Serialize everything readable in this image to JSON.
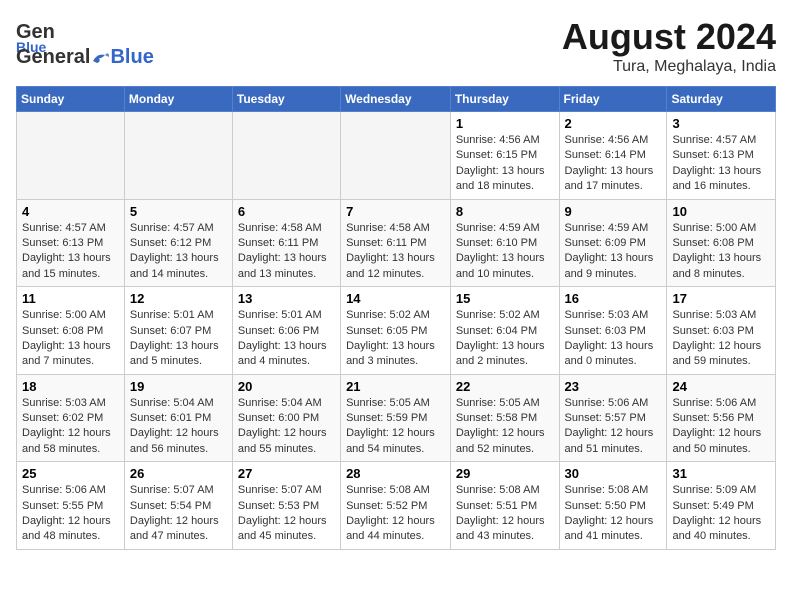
{
  "header": {
    "logo_general": "General",
    "logo_blue": "Blue",
    "title": "August 2024",
    "subtitle": "Tura, Meghalaya, India"
  },
  "weekdays": [
    "Sunday",
    "Monday",
    "Tuesday",
    "Wednesday",
    "Thursday",
    "Friday",
    "Saturday"
  ],
  "weeks": [
    [
      {
        "day": "",
        "info": ""
      },
      {
        "day": "",
        "info": ""
      },
      {
        "day": "",
        "info": ""
      },
      {
        "day": "",
        "info": ""
      },
      {
        "day": "1",
        "info": "Sunrise: 4:56 AM\nSunset: 6:15 PM\nDaylight: 13 hours\nand 18 minutes."
      },
      {
        "day": "2",
        "info": "Sunrise: 4:56 AM\nSunset: 6:14 PM\nDaylight: 13 hours\nand 17 minutes."
      },
      {
        "day": "3",
        "info": "Sunrise: 4:57 AM\nSunset: 6:13 PM\nDaylight: 13 hours\nand 16 minutes."
      }
    ],
    [
      {
        "day": "4",
        "info": "Sunrise: 4:57 AM\nSunset: 6:13 PM\nDaylight: 13 hours\nand 15 minutes."
      },
      {
        "day": "5",
        "info": "Sunrise: 4:57 AM\nSunset: 6:12 PM\nDaylight: 13 hours\nand 14 minutes."
      },
      {
        "day": "6",
        "info": "Sunrise: 4:58 AM\nSunset: 6:11 PM\nDaylight: 13 hours\nand 13 minutes."
      },
      {
        "day": "7",
        "info": "Sunrise: 4:58 AM\nSunset: 6:11 PM\nDaylight: 13 hours\nand 12 minutes."
      },
      {
        "day": "8",
        "info": "Sunrise: 4:59 AM\nSunset: 6:10 PM\nDaylight: 13 hours\nand 10 minutes."
      },
      {
        "day": "9",
        "info": "Sunrise: 4:59 AM\nSunset: 6:09 PM\nDaylight: 13 hours\nand 9 minutes."
      },
      {
        "day": "10",
        "info": "Sunrise: 5:00 AM\nSunset: 6:08 PM\nDaylight: 13 hours\nand 8 minutes."
      }
    ],
    [
      {
        "day": "11",
        "info": "Sunrise: 5:00 AM\nSunset: 6:08 PM\nDaylight: 13 hours\nand 7 minutes."
      },
      {
        "day": "12",
        "info": "Sunrise: 5:01 AM\nSunset: 6:07 PM\nDaylight: 13 hours\nand 5 minutes."
      },
      {
        "day": "13",
        "info": "Sunrise: 5:01 AM\nSunset: 6:06 PM\nDaylight: 13 hours\nand 4 minutes."
      },
      {
        "day": "14",
        "info": "Sunrise: 5:02 AM\nSunset: 6:05 PM\nDaylight: 13 hours\nand 3 minutes."
      },
      {
        "day": "15",
        "info": "Sunrise: 5:02 AM\nSunset: 6:04 PM\nDaylight: 13 hours\nand 2 minutes."
      },
      {
        "day": "16",
        "info": "Sunrise: 5:03 AM\nSunset: 6:03 PM\nDaylight: 13 hours\nand 0 minutes."
      },
      {
        "day": "17",
        "info": "Sunrise: 5:03 AM\nSunset: 6:03 PM\nDaylight: 12 hours\nand 59 minutes."
      }
    ],
    [
      {
        "day": "18",
        "info": "Sunrise: 5:03 AM\nSunset: 6:02 PM\nDaylight: 12 hours\nand 58 minutes."
      },
      {
        "day": "19",
        "info": "Sunrise: 5:04 AM\nSunset: 6:01 PM\nDaylight: 12 hours\nand 56 minutes."
      },
      {
        "day": "20",
        "info": "Sunrise: 5:04 AM\nSunset: 6:00 PM\nDaylight: 12 hours\nand 55 minutes."
      },
      {
        "day": "21",
        "info": "Sunrise: 5:05 AM\nSunset: 5:59 PM\nDaylight: 12 hours\nand 54 minutes."
      },
      {
        "day": "22",
        "info": "Sunrise: 5:05 AM\nSunset: 5:58 PM\nDaylight: 12 hours\nand 52 minutes."
      },
      {
        "day": "23",
        "info": "Sunrise: 5:06 AM\nSunset: 5:57 PM\nDaylight: 12 hours\nand 51 minutes."
      },
      {
        "day": "24",
        "info": "Sunrise: 5:06 AM\nSunset: 5:56 PM\nDaylight: 12 hours\nand 50 minutes."
      }
    ],
    [
      {
        "day": "25",
        "info": "Sunrise: 5:06 AM\nSunset: 5:55 PM\nDaylight: 12 hours\nand 48 minutes."
      },
      {
        "day": "26",
        "info": "Sunrise: 5:07 AM\nSunset: 5:54 PM\nDaylight: 12 hours\nand 47 minutes."
      },
      {
        "day": "27",
        "info": "Sunrise: 5:07 AM\nSunset: 5:53 PM\nDaylight: 12 hours\nand 45 minutes."
      },
      {
        "day": "28",
        "info": "Sunrise: 5:08 AM\nSunset: 5:52 PM\nDaylight: 12 hours\nand 44 minutes."
      },
      {
        "day": "29",
        "info": "Sunrise: 5:08 AM\nSunset: 5:51 PM\nDaylight: 12 hours\nand 43 minutes."
      },
      {
        "day": "30",
        "info": "Sunrise: 5:08 AM\nSunset: 5:50 PM\nDaylight: 12 hours\nand 41 minutes."
      },
      {
        "day": "31",
        "info": "Sunrise: 5:09 AM\nSunset: 5:49 PM\nDaylight: 12 hours\nand 40 minutes."
      }
    ]
  ]
}
